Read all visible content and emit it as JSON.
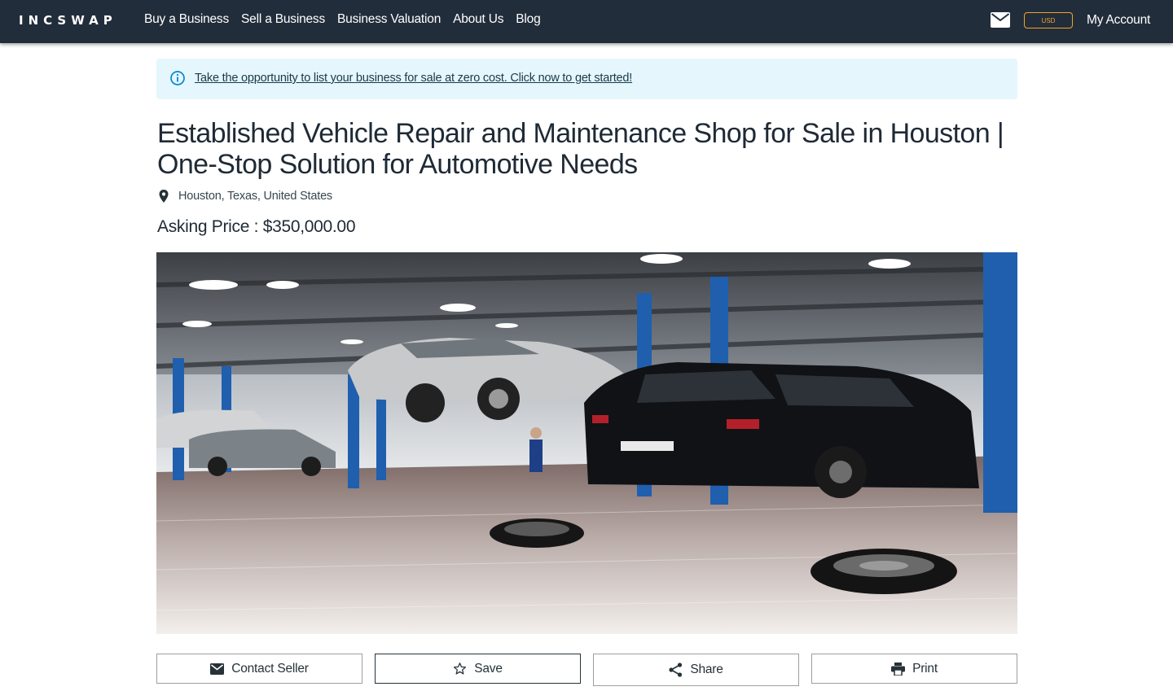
{
  "navbar": {
    "logo": "INCSWAP",
    "links": [
      "Buy a Business",
      "Sell a Business",
      "Business Valuation",
      "About Us",
      "Blog"
    ],
    "currency": "USD",
    "account": "My Account",
    "icons": {
      "mail": "mail-icon"
    }
  },
  "alert": {
    "text": "Take the opportunity to list your business for sale at zero cost. Click now to get started!",
    "icon": "info-icon"
  },
  "listing": {
    "title": "Established Vehicle Repair and Maintenance Shop for Sale in Houston | One-Stop Solution for Automotive Needs",
    "location": "Houston, Texas, United States",
    "price": "Asking Price : $350,000.00",
    "image": "auto-repair-garage-photo"
  },
  "actions": {
    "contact": "Contact Seller",
    "save": "Save",
    "share": "Share",
    "print": "Print"
  },
  "colors": {
    "navbar_bg": "#222d3b",
    "alert_bg": "#e5f6fd",
    "currency_accent": "#f0a326",
    "alert_icon": "#0288d1"
  }
}
